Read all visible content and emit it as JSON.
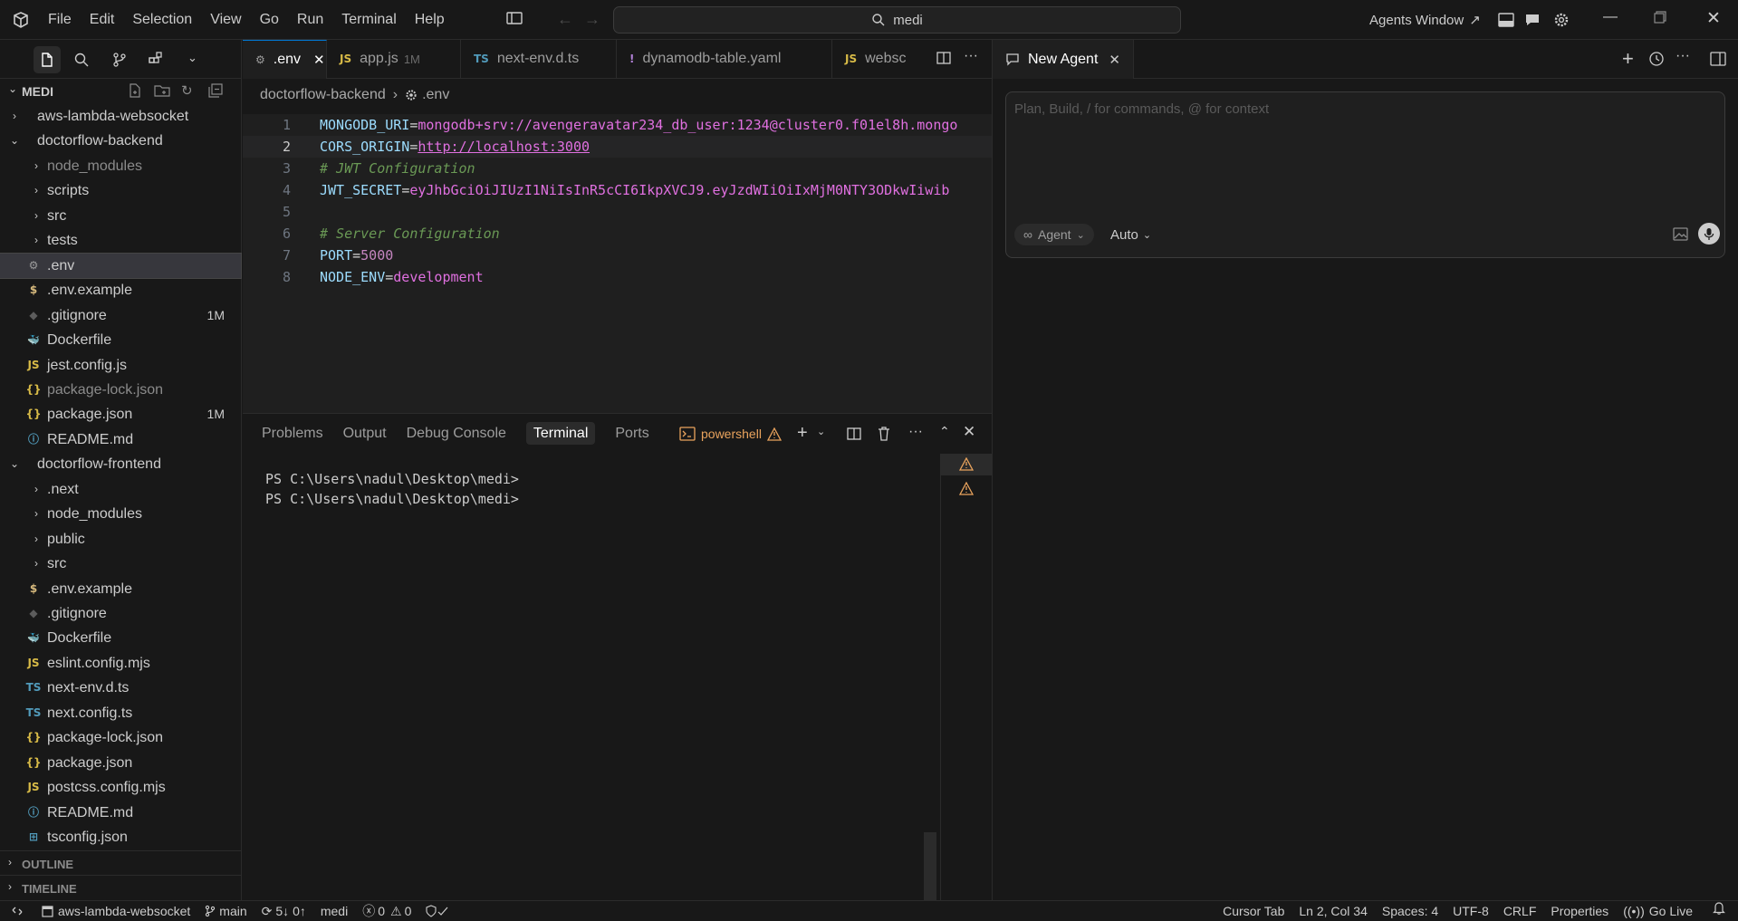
{
  "menu": [
    "File",
    "Edit",
    "Selection",
    "View",
    "Go",
    "Run",
    "Terminal",
    "Help"
  ],
  "search": {
    "text": "medi"
  },
  "agents_window": "Agents Window",
  "explorer": {
    "root": "MEDI",
    "items": [
      {
        "label": "aws-lambda-websocket",
        "type": "folder",
        "open": false,
        "depth": 0
      },
      {
        "label": "doctorflow-backend",
        "type": "folder",
        "open": true,
        "depth": 0
      },
      {
        "label": "node_modules",
        "type": "folder",
        "open": false,
        "depth": 1,
        "dim": true
      },
      {
        "label": "scripts",
        "type": "folder",
        "open": false,
        "depth": 1
      },
      {
        "label": "src",
        "type": "folder",
        "open": false,
        "depth": 1
      },
      {
        "label": "tests",
        "type": "folder",
        "open": false,
        "depth": 1
      },
      {
        "label": ".env",
        "type": "file",
        "icon": "gear",
        "depth": 1,
        "selected": true
      },
      {
        "label": ".env.example",
        "type": "file",
        "icon": "dollar",
        "depth": 1
      },
      {
        "label": ".gitignore",
        "type": "file",
        "icon": "git",
        "depth": 1,
        "badge": "1M"
      },
      {
        "label": "Dockerfile",
        "type": "file",
        "icon": "docker",
        "depth": 1
      },
      {
        "label": "jest.config.js",
        "type": "file",
        "icon": "js",
        "depth": 1
      },
      {
        "label": "package-lock.json",
        "type": "file",
        "icon": "json",
        "depth": 1,
        "dim": true
      },
      {
        "label": "package.json",
        "type": "file",
        "icon": "json",
        "depth": 1,
        "badge": "1M"
      },
      {
        "label": "README.md",
        "type": "file",
        "icon": "info",
        "depth": 1
      },
      {
        "label": "doctorflow-frontend",
        "type": "folder",
        "open": true,
        "depth": 0
      },
      {
        "label": ".next",
        "type": "folder",
        "open": false,
        "depth": 1
      },
      {
        "label": "node_modules",
        "type": "folder",
        "open": false,
        "depth": 1
      },
      {
        "label": "public",
        "type": "folder",
        "open": false,
        "depth": 1
      },
      {
        "label": "src",
        "type": "folder",
        "open": false,
        "depth": 1
      },
      {
        "label": ".env.example",
        "type": "file",
        "icon": "dollar",
        "depth": 1
      },
      {
        "label": ".gitignore",
        "type": "file",
        "icon": "git",
        "depth": 1
      },
      {
        "label": "Dockerfile",
        "type": "file",
        "icon": "docker",
        "depth": 1
      },
      {
        "label": "eslint.config.mjs",
        "type": "file",
        "icon": "js",
        "depth": 1
      },
      {
        "label": "next-env.d.ts",
        "type": "file",
        "icon": "ts",
        "depth": 1
      },
      {
        "label": "next.config.ts",
        "type": "file",
        "icon": "ts",
        "depth": 1
      },
      {
        "label": "package-lock.json",
        "type": "file",
        "icon": "json",
        "depth": 1
      },
      {
        "label": "package.json",
        "type": "file",
        "icon": "json",
        "depth": 1
      },
      {
        "label": "postcss.config.mjs",
        "type": "file",
        "icon": "js",
        "depth": 1
      },
      {
        "label": "README.md",
        "type": "file",
        "icon": "info",
        "depth": 1
      },
      {
        "label": "tsconfig.json",
        "type": "file",
        "icon": "tsconfig",
        "depth": 1
      }
    ],
    "outline": "OUTLINE",
    "timeline": "TIMELINE"
  },
  "tabs": [
    {
      "label": ".env",
      "icon": "gear",
      "active": true
    },
    {
      "label": "app.js",
      "icon": "js",
      "badge": "1M"
    },
    {
      "label": "next-env.d.ts",
      "icon": "ts"
    },
    {
      "label": "dynamodb-table.yaml",
      "icon": "yaml"
    },
    {
      "label": "websc",
      "icon": "js"
    }
  ],
  "breadcrumb": {
    "folder": "doctorflow-backend",
    "file": ".env"
  },
  "code": [
    {
      "n": "1",
      "parts": [
        [
          "k",
          "MONGODB_URI"
        ],
        [
          "eq",
          "="
        ],
        [
          "str",
          "mongodb+srv://avengeravatar234_db_user:1234@cluster0.f01el8h.mongo"
        ]
      ]
    },
    {
      "n": "2",
      "parts": [
        [
          "k",
          "CORS_ORIGIN"
        ],
        [
          "eq",
          "="
        ],
        [
          "link",
          "http://localhost:3000"
        ]
      ]
    },
    {
      "n": "3",
      "parts": [
        [
          "cmt",
          "# JWT Configuration"
        ]
      ]
    },
    {
      "n": "4",
      "parts": [
        [
          "k",
          "JWT_SECRET"
        ],
        [
          "eq",
          "="
        ],
        [
          "str",
          "eyJhbGciOiJIUzI1NiIsInR5cCI6IkpXVCJ9.eyJzdWIiOiIxMjM0NTY3ODkwIiwib"
        ]
      ]
    },
    {
      "n": "5",
      "parts": []
    },
    {
      "n": "6",
      "parts": [
        [
          "cmt",
          "# Server Configuration"
        ]
      ]
    },
    {
      "n": "7",
      "parts": [
        [
          "k",
          "PORT"
        ],
        [
          "eq",
          "="
        ],
        [
          "num",
          "5000"
        ]
      ]
    },
    {
      "n": "8",
      "parts": [
        [
          "k",
          "NODE_ENV"
        ],
        [
          "eq",
          "="
        ],
        [
          "str",
          "development"
        ]
      ]
    }
  ],
  "panel": {
    "tabs": [
      "Problems",
      "Output",
      "Debug Console",
      "Terminal",
      "Ports"
    ],
    "active_tab": "Terminal",
    "shell": "powershell",
    "lines": [
      "PS C:\\Users\\nadul\\Desktop\\medi>",
      "PS C:\\Users\\nadul\\Desktop\\medi>"
    ]
  },
  "agent": {
    "tab_label": "New Agent",
    "placeholder": "Plan, Build, / for commands, @ for context",
    "mode": "Agent",
    "model": "Auto"
  },
  "status": {
    "workspace": "aws-lambda-websocket",
    "branch": "main",
    "sync": "5↓ 0↑",
    "folder": "medi",
    "errors": "0",
    "warnings": "0",
    "cursor_tab": "Cursor Tab",
    "position": "Ln 2, Col 34",
    "spaces": "Spaces: 4",
    "encoding": "UTF-8",
    "eol": "CRLF",
    "language": "Properties",
    "go_live": "Go Live"
  },
  "colors": {
    "accent": "#0078d4",
    "warning": "#cca700",
    "bg": "#181818",
    "editor_bg": "#1f1f1f"
  }
}
